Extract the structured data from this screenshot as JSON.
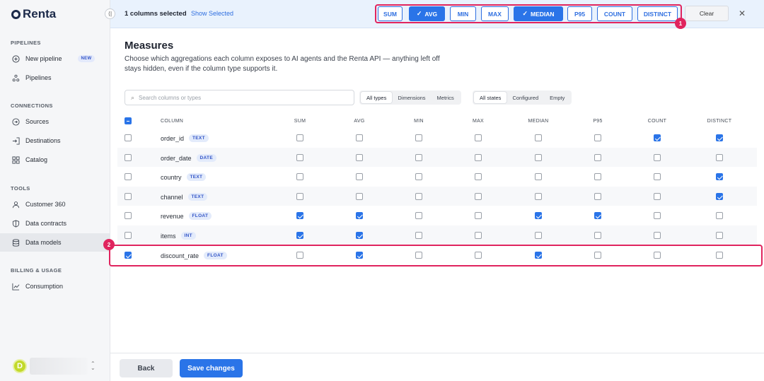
{
  "app": {
    "name": "Renta"
  },
  "sidebar": {
    "sections": [
      {
        "label": "PIPELINES",
        "items": [
          {
            "label": "New pipeline",
            "icon": "plus-circle-icon",
            "badge": "NEW"
          },
          {
            "label": "Pipelines",
            "icon": "nodes-icon"
          }
        ]
      },
      {
        "label": "CONNECTIONS",
        "items": [
          {
            "label": "Sources",
            "icon": "arrow-out-icon"
          },
          {
            "label": "Destinations",
            "icon": "arrow-in-icon"
          },
          {
            "label": "Catalog",
            "icon": "grid-icon"
          }
        ]
      },
      {
        "label": "TOOLS",
        "items": [
          {
            "label": "Customer 360",
            "icon": "user-icon"
          },
          {
            "label": "Data contracts",
            "icon": "shield-icon"
          },
          {
            "label": "Data models",
            "icon": "database-icon",
            "active": true
          }
        ]
      },
      {
        "label": "BILLING & USAGE",
        "items": [
          {
            "label": "Consumption",
            "icon": "chart-icon"
          }
        ]
      }
    ],
    "user": {
      "initial": "D"
    }
  },
  "topbar": {
    "selected_count": "1 columns selected",
    "show_selected": "Show Selected",
    "aggregations": [
      {
        "label": "SUM",
        "active": false
      },
      {
        "label": "AVG",
        "active": true
      },
      {
        "label": "MIN",
        "active": false
      },
      {
        "label": "MAX",
        "active": false
      },
      {
        "label": "MEDIAN",
        "active": true
      },
      {
        "label": "P95",
        "active": false
      },
      {
        "label": "COUNT",
        "active": false
      },
      {
        "label": "DISTINCT",
        "active": false
      }
    ],
    "clear_label": "Clear"
  },
  "callouts": {
    "one": "1",
    "two": "2"
  },
  "main": {
    "title": "Measures",
    "description": "Choose which aggregations each column exposes to AI agents and the Renta API — anything left off stays hidden, even if the column type supports it.",
    "search_placeholder": "Search columns or types",
    "type_filters": [
      "All types",
      "Dimensions",
      "Metrics"
    ],
    "state_filters": [
      "All states",
      "Configured",
      "Empty"
    ],
    "columns": [
      "COLUMN",
      "SUM",
      "AVG",
      "MIN",
      "MAX",
      "MEDIAN",
      "P95",
      "COUNT",
      "DISTINCT"
    ]
  },
  "rows": [
    {
      "name": "order_id",
      "type": "TEXT",
      "selected": false,
      "checks": [
        false,
        false,
        false,
        false,
        false,
        false,
        true,
        true
      ]
    },
    {
      "name": "order_date",
      "type": "DATE",
      "selected": false,
      "checks": [
        false,
        false,
        false,
        false,
        false,
        false,
        false,
        false
      ]
    },
    {
      "name": "country",
      "type": "TEXT",
      "selected": false,
      "checks": [
        false,
        false,
        false,
        false,
        false,
        false,
        false,
        true
      ]
    },
    {
      "name": "channel",
      "type": "TEXT",
      "selected": false,
      "checks": [
        false,
        false,
        false,
        false,
        false,
        false,
        false,
        true
      ]
    },
    {
      "name": "revenue",
      "type": "FLOAT",
      "selected": false,
      "checks": [
        true,
        true,
        false,
        false,
        true,
        true,
        false,
        false
      ]
    },
    {
      "name": "items",
      "type": "INT",
      "selected": false,
      "checks": [
        true,
        true,
        false,
        false,
        false,
        false,
        false,
        false
      ]
    },
    {
      "name": "discount_rate",
      "type": "FLOAT",
      "selected": true,
      "checks": [
        false,
        true,
        false,
        false,
        true,
        false,
        false,
        false
      ]
    }
  ],
  "footer": {
    "back_label": "Back",
    "save_label": "Save changes"
  }
}
